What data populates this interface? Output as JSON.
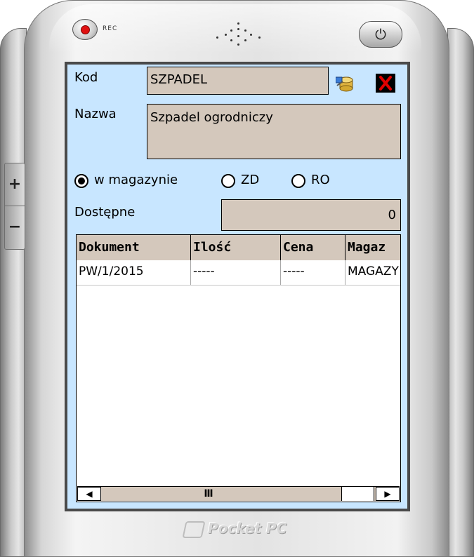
{
  "device": {
    "rec_label": "REC",
    "footer_brand": "Pocket PC"
  },
  "form": {
    "kod_label": "Kod",
    "kod_value": "SZPADEL",
    "nazwa_label": "Nazwa",
    "nazwa_value": "Szpadel ogrodniczy",
    "radios": [
      {
        "label": "w magazynie",
        "selected": true
      },
      {
        "label": "ZD",
        "selected": false
      },
      {
        "label": "RO",
        "selected": false
      }
    ],
    "dostepne_label": "Dostępne",
    "dostepne_value": "0"
  },
  "table": {
    "columns": [
      "Dokument",
      "Ilość",
      "Cena",
      "Magaz"
    ],
    "rows": [
      [
        "PW/1/2015",
        "-----",
        "-----",
        "MAGAZY"
      ]
    ]
  },
  "icons": {
    "lookup": "database-search-icon",
    "close": "red-x-close-icon",
    "scroll_left": "arrow-left-icon",
    "scroll_right": "arrow-right-icon",
    "power": "power-icon"
  },
  "colors": {
    "background": "#c8e6ff",
    "field": "#d4c8bc",
    "close_x": "#e00000"
  }
}
